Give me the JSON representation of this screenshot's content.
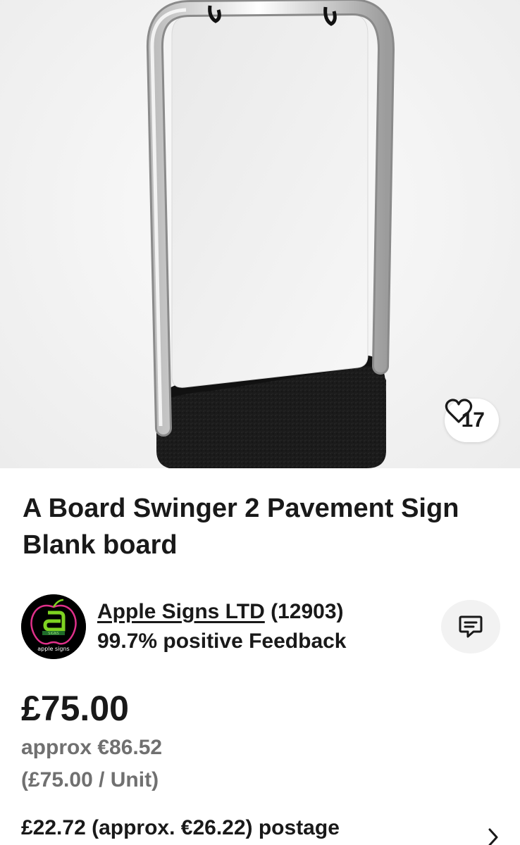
{
  "product": {
    "title": "A Board Swinger 2 Pavement Sign Blank board",
    "watch_count": "17",
    "watch_icon": "heart-icon"
  },
  "seller": {
    "logo_icon": "apple-signs-logo",
    "name": "Apple Signs LTD",
    "feedback_count": "(12903)",
    "feedback_summary": "99.7% positive Feedback",
    "message_icon": "chat-icon"
  },
  "pricing": {
    "price": "£75.00",
    "approx": "approx €86.52",
    "unit_price": "(£75.00 / Unit)",
    "postage": "£22.72 (approx. €26.22) postage"
  },
  "colors": {
    "text": "#191919",
    "secondary_text": "#707070",
    "logo_green": "#7ed321"
  }
}
